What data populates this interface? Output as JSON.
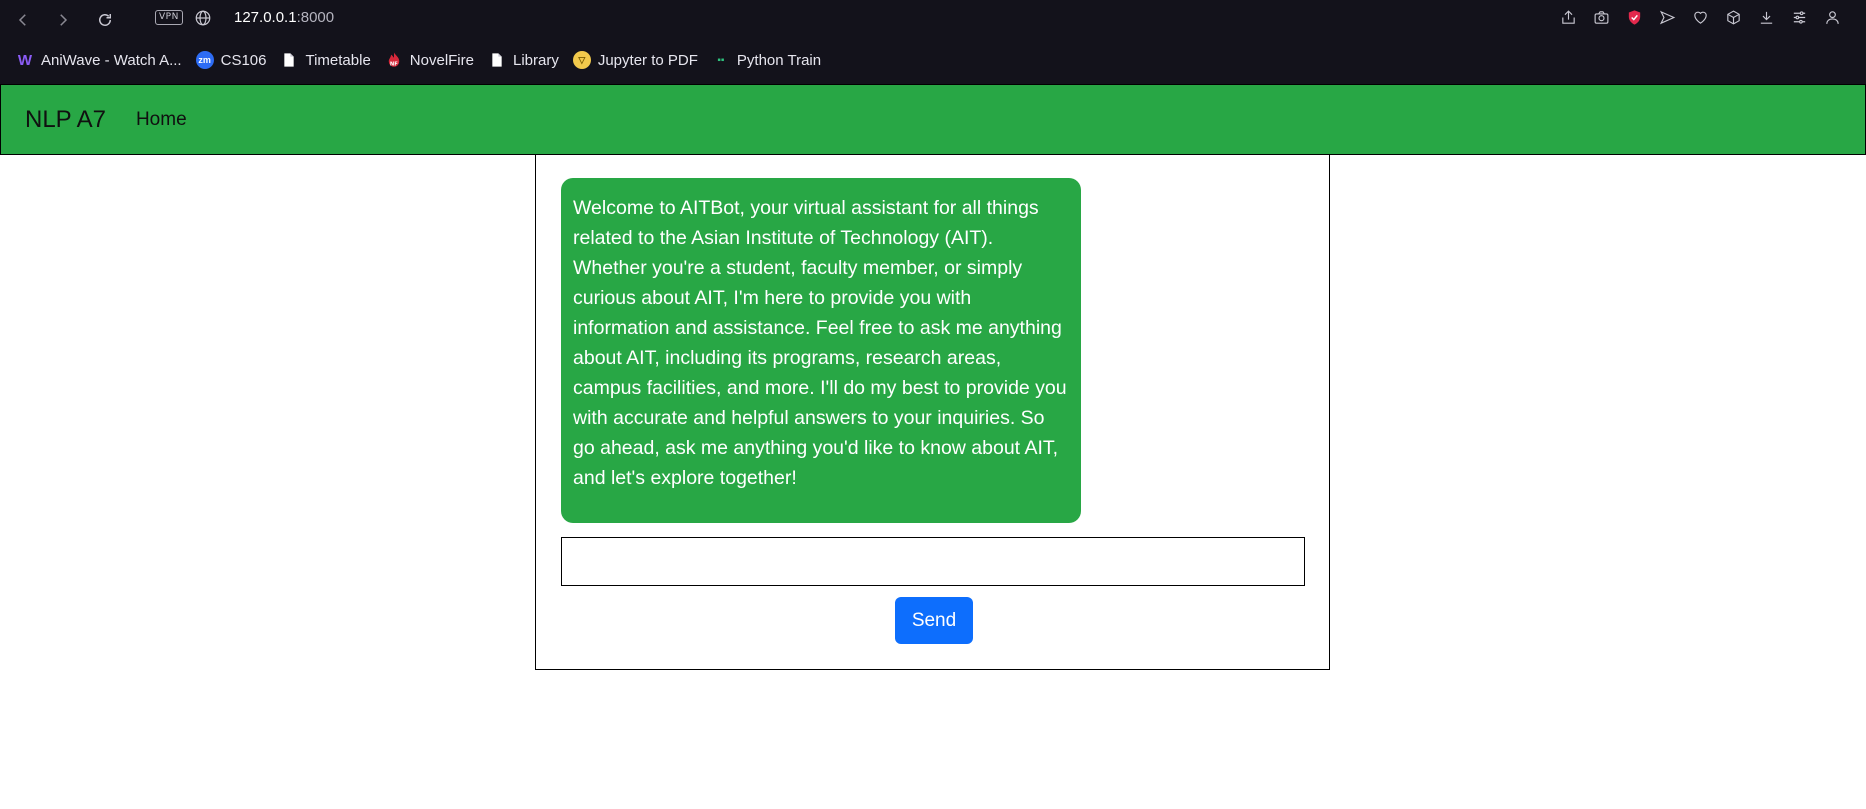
{
  "browser": {
    "vpn_label": "VPN",
    "url_host": "127.0.0.1",
    "url_port": ":8000",
    "bookmarks": [
      {
        "label": "AniWave - Watch A...",
        "icon": "aniwave-icon",
        "color": "#7b3fe4",
        "glyph": "W"
      },
      {
        "label": "CS106",
        "icon": "zoom-icon",
        "color": "#2d6cf5",
        "glyph": "zm"
      },
      {
        "label": "Timetable",
        "icon": "file-icon",
        "color": "#ffffff",
        "glyph": ""
      },
      {
        "label": "NovelFire",
        "icon": "novelfire-icon",
        "color": "#d6283a",
        "glyph": "NF"
      },
      {
        "label": "Library",
        "icon": "file-icon",
        "color": "#ffffff",
        "glyph": ""
      },
      {
        "label": "Jupyter to PDF",
        "icon": "jupyter-icon",
        "color": "#f2c94c",
        "glyph": "▽"
      },
      {
        "label": "Python Train",
        "icon": "python-train-icon",
        "color": "#2ec27e",
        "glyph": "▪▪"
      }
    ]
  },
  "navbar": {
    "brand": "NLP A7",
    "home_link": "Home"
  },
  "chat": {
    "bot_message": "Welcome to AITBot, your virtual assistant for all things related to the Asian Institute of Technology (AIT). Whether you're a student, faculty member, or simply curious about AIT, I'm here to provide you with information and assistance. Feel free to ask me anything about AIT, including its programs, research areas, campus facilities, and more. I'll do my best to provide you with accurate and helpful answers to your inquiries. So go ahead, ask me anything you'd like to know about AIT, and let's explore together!",
    "input_value": "",
    "input_placeholder": "",
    "send_label": "Send"
  },
  "colors": {
    "accent_green": "#28a745",
    "send_blue": "#0d6efd",
    "browser_dark": "#13121b"
  }
}
